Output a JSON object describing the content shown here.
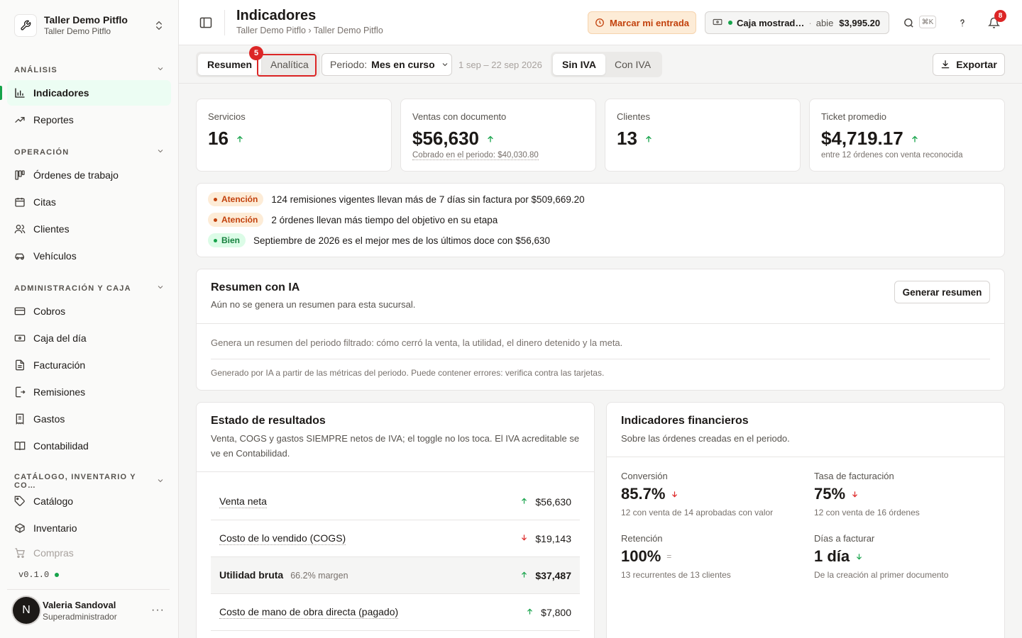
{
  "org": {
    "name": "Taller Demo Pitflo",
    "branch": "Taller Demo Pitflo"
  },
  "sidebar": {
    "analysis_title": "ANÁLISIS",
    "analysis_items": [
      {
        "label": "Indicadores",
        "icon": "bar-chart-icon",
        "active": true
      },
      {
        "label": "Reportes",
        "icon": "trending-up-icon"
      }
    ],
    "operation_title": "OPERACIÓN",
    "operation_items": [
      {
        "label": "Órdenes de trabajo",
        "icon": "kanban-icon"
      },
      {
        "label": "Citas",
        "icon": "calendar-icon"
      },
      {
        "label": "Clientes",
        "icon": "users-icon"
      },
      {
        "label": "Vehículos",
        "icon": "car-icon"
      }
    ],
    "admin_title": "ADMINISTRACIÓN Y CAJA",
    "admin_items": [
      {
        "label": "Cobros",
        "icon": "credit-card-icon"
      },
      {
        "label": "Caja del día",
        "icon": "banknote-icon"
      },
      {
        "label": "Facturación",
        "icon": "file-text-icon"
      },
      {
        "label": "Remisiones",
        "icon": "file-export-icon"
      },
      {
        "label": "Gastos",
        "icon": "receipt-icon"
      },
      {
        "label": "Contabilidad",
        "icon": "book-icon"
      }
    ],
    "catalog_title": "CATÁLOGO, INVENTARIO Y CO…",
    "catalog_items": [
      {
        "label": "Catálogo",
        "icon": "tag-icon"
      },
      {
        "label": "Inventario",
        "icon": "box-icon"
      },
      {
        "label": "Compras",
        "icon": "cart-icon"
      }
    ],
    "version": "v0.1.0"
  },
  "user": {
    "initial": "N",
    "name": "Valeria Sandoval",
    "role": "Superadministrador"
  },
  "header": {
    "title": "Indicadores",
    "breadcrumb": "Taller Demo Pitflo › Taller Demo Pitflo",
    "entry_button": "Marcar mi entrada",
    "cash": {
      "name": "Caja mostrad…",
      "state": "abie",
      "amount": "$3,995.20"
    },
    "shortcut": "⌘K",
    "notifications": "8"
  },
  "toolbar": {
    "tabs": [
      "Resumen",
      "Analítica"
    ],
    "highlight_badge": "5",
    "period_label": "Periodo:",
    "period_value": "Mes en curso",
    "date_range": "1 sep – 22 sep 2026",
    "iva_options": [
      "Sin IVA",
      "Con IVA"
    ],
    "export_label": "Exportar"
  },
  "kpis": [
    {
      "label": "Servicios",
      "value": "16",
      "note": ""
    },
    {
      "label": "Ventas con documento",
      "value": "$56,630",
      "note": "Cobrado en el periodo: $40,030.80"
    },
    {
      "label": "Clientes",
      "value": "13",
      "note": ""
    },
    {
      "label": "Ticket promedio",
      "value": "$4,719.17",
      "note": "entre 12 órdenes con venta reconocida"
    }
  ],
  "alerts": [
    {
      "level": "warn",
      "tag": "Atención",
      "text": "124 remisiones vigentes llevan más de 7 días sin factura por $509,669.20"
    },
    {
      "level": "warn",
      "tag": "Atención",
      "text": "2 órdenes llevan más tiempo del objetivo en su etapa"
    },
    {
      "level": "good",
      "tag": "Bien",
      "text": "Septiembre de 2026 es el mejor mes de los últimos doce con $56,630"
    }
  ],
  "ai": {
    "title": "Resumen con IA",
    "subtitle": "Aún no se genera un resumen para esta sucursal.",
    "button": "Generar resumen",
    "description": "Genera un resumen del periodo filtrado: cómo cerró la venta, la utilidad, el dinero detenido y la meta.",
    "footnote": "Generado por IA a partir de las métricas del periodo. Puede contener errores: verifica contra las tarjetas."
  },
  "income": {
    "title": "Estado de resultados",
    "subtitle": "Venta, COGS y gastos SIEMPRE netos de IVA; el toggle no los toca. El IVA acreditable se ve en Contabilidad.",
    "rows": [
      {
        "label": "Venta neta",
        "trend": "up",
        "amount": "$56,630",
        "margin": ""
      },
      {
        "label": "Costo de lo vendido (COGS)",
        "trend": "down",
        "amount": "$19,143",
        "margin": ""
      },
      {
        "label": "Utilidad bruta",
        "trend": "up",
        "amount": "$37,487",
        "margin": "66.2% margen"
      },
      {
        "label": "Costo de mano de obra directa (pagado)",
        "trend": "up",
        "amount": "$7,800",
        "margin": ""
      }
    ]
  },
  "financial": {
    "title": "Indicadores financieros",
    "subtitle": "Sobre las órdenes creadas en el periodo.",
    "items": [
      {
        "label": "Conversión",
        "value": "85.7%",
        "trend": "down",
        "note": "12 con venta de 14 aprobadas con valor"
      },
      {
        "label": "Tasa de facturación",
        "value": "75%",
        "trend": "down",
        "note": "12 con venta de 16 órdenes"
      },
      {
        "label": "Retención",
        "value": "100%",
        "trend": "flat",
        "note": "13 recurrentes de 13 clientes"
      },
      {
        "label": "Días a facturar",
        "value": "1 día",
        "trend": "down",
        "note": "De la creación al primer documento"
      }
    ]
  },
  "colors": {
    "accent": "#16a34a",
    "warning": "#c2410c",
    "danger": "#dc2626"
  }
}
